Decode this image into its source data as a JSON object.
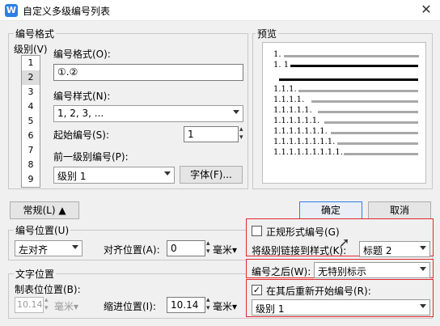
{
  "window": {
    "title": "自定义多级编号列表",
    "logo": "W"
  },
  "number_format": {
    "group_label": "编号格式",
    "level_label": "级别(V)",
    "levels": [
      "1",
      "2",
      "3",
      "4",
      "5",
      "6",
      "7",
      "8",
      "9"
    ],
    "format_label": "编号格式(O):",
    "format_value": "①.②",
    "style_label": "编号样式(N):",
    "style_value": "1, 2, 3, ...",
    "start_label": "起始编号(S):",
    "start_value": "1",
    "prev_level_label": "前一级别编号(P):",
    "prev_level_value": "级别 1",
    "font_button": "字体(F)..."
  },
  "preview": {
    "label": "预览",
    "rows": [
      {
        "num": "1."
      },
      {
        "num": "1. 1"
      },
      {
        "num": ""
      },
      {
        "num": "1.1.1."
      },
      {
        "num": "1.1.1.1."
      },
      {
        "num": "1.1.1.1.1."
      },
      {
        "num": "1.1.1.1.1.1."
      },
      {
        "num": "1.1.1.1.1.1.1."
      },
      {
        "num": "1.1.1.1.1.1.1.1."
      },
      {
        "num": "1.1.1.1.1.1.1.1.1."
      }
    ]
  },
  "buttons": {
    "normal": "常规(L) ▲",
    "ok": "确定",
    "cancel": "取消"
  },
  "number_position": {
    "group_label": "编号位置(U)",
    "align_value": "左对齐",
    "align_pos_label": "对齐位置(A):",
    "align_pos_value": "0",
    "unit": "毫米▾"
  },
  "text_position": {
    "group_label": "文字位置",
    "tab_label": "制表位位置(B):",
    "tab_value": "10.14",
    "tab_unit": "毫米▾",
    "indent_label": "缩进位置(I):",
    "indent_value": "10.14",
    "indent_unit": "毫米▾"
  },
  "options": {
    "legal_label": "正规形式编号(G)",
    "legal_checked": false,
    "link_label": "将级别链接到样式(K):",
    "link_value": "标题 2",
    "after_label": "编号之后(W):",
    "after_value": "无特别标示",
    "restart_label": "在其后重新开始编号(R):",
    "restart_checked": true,
    "restart_value": "级别 1"
  }
}
